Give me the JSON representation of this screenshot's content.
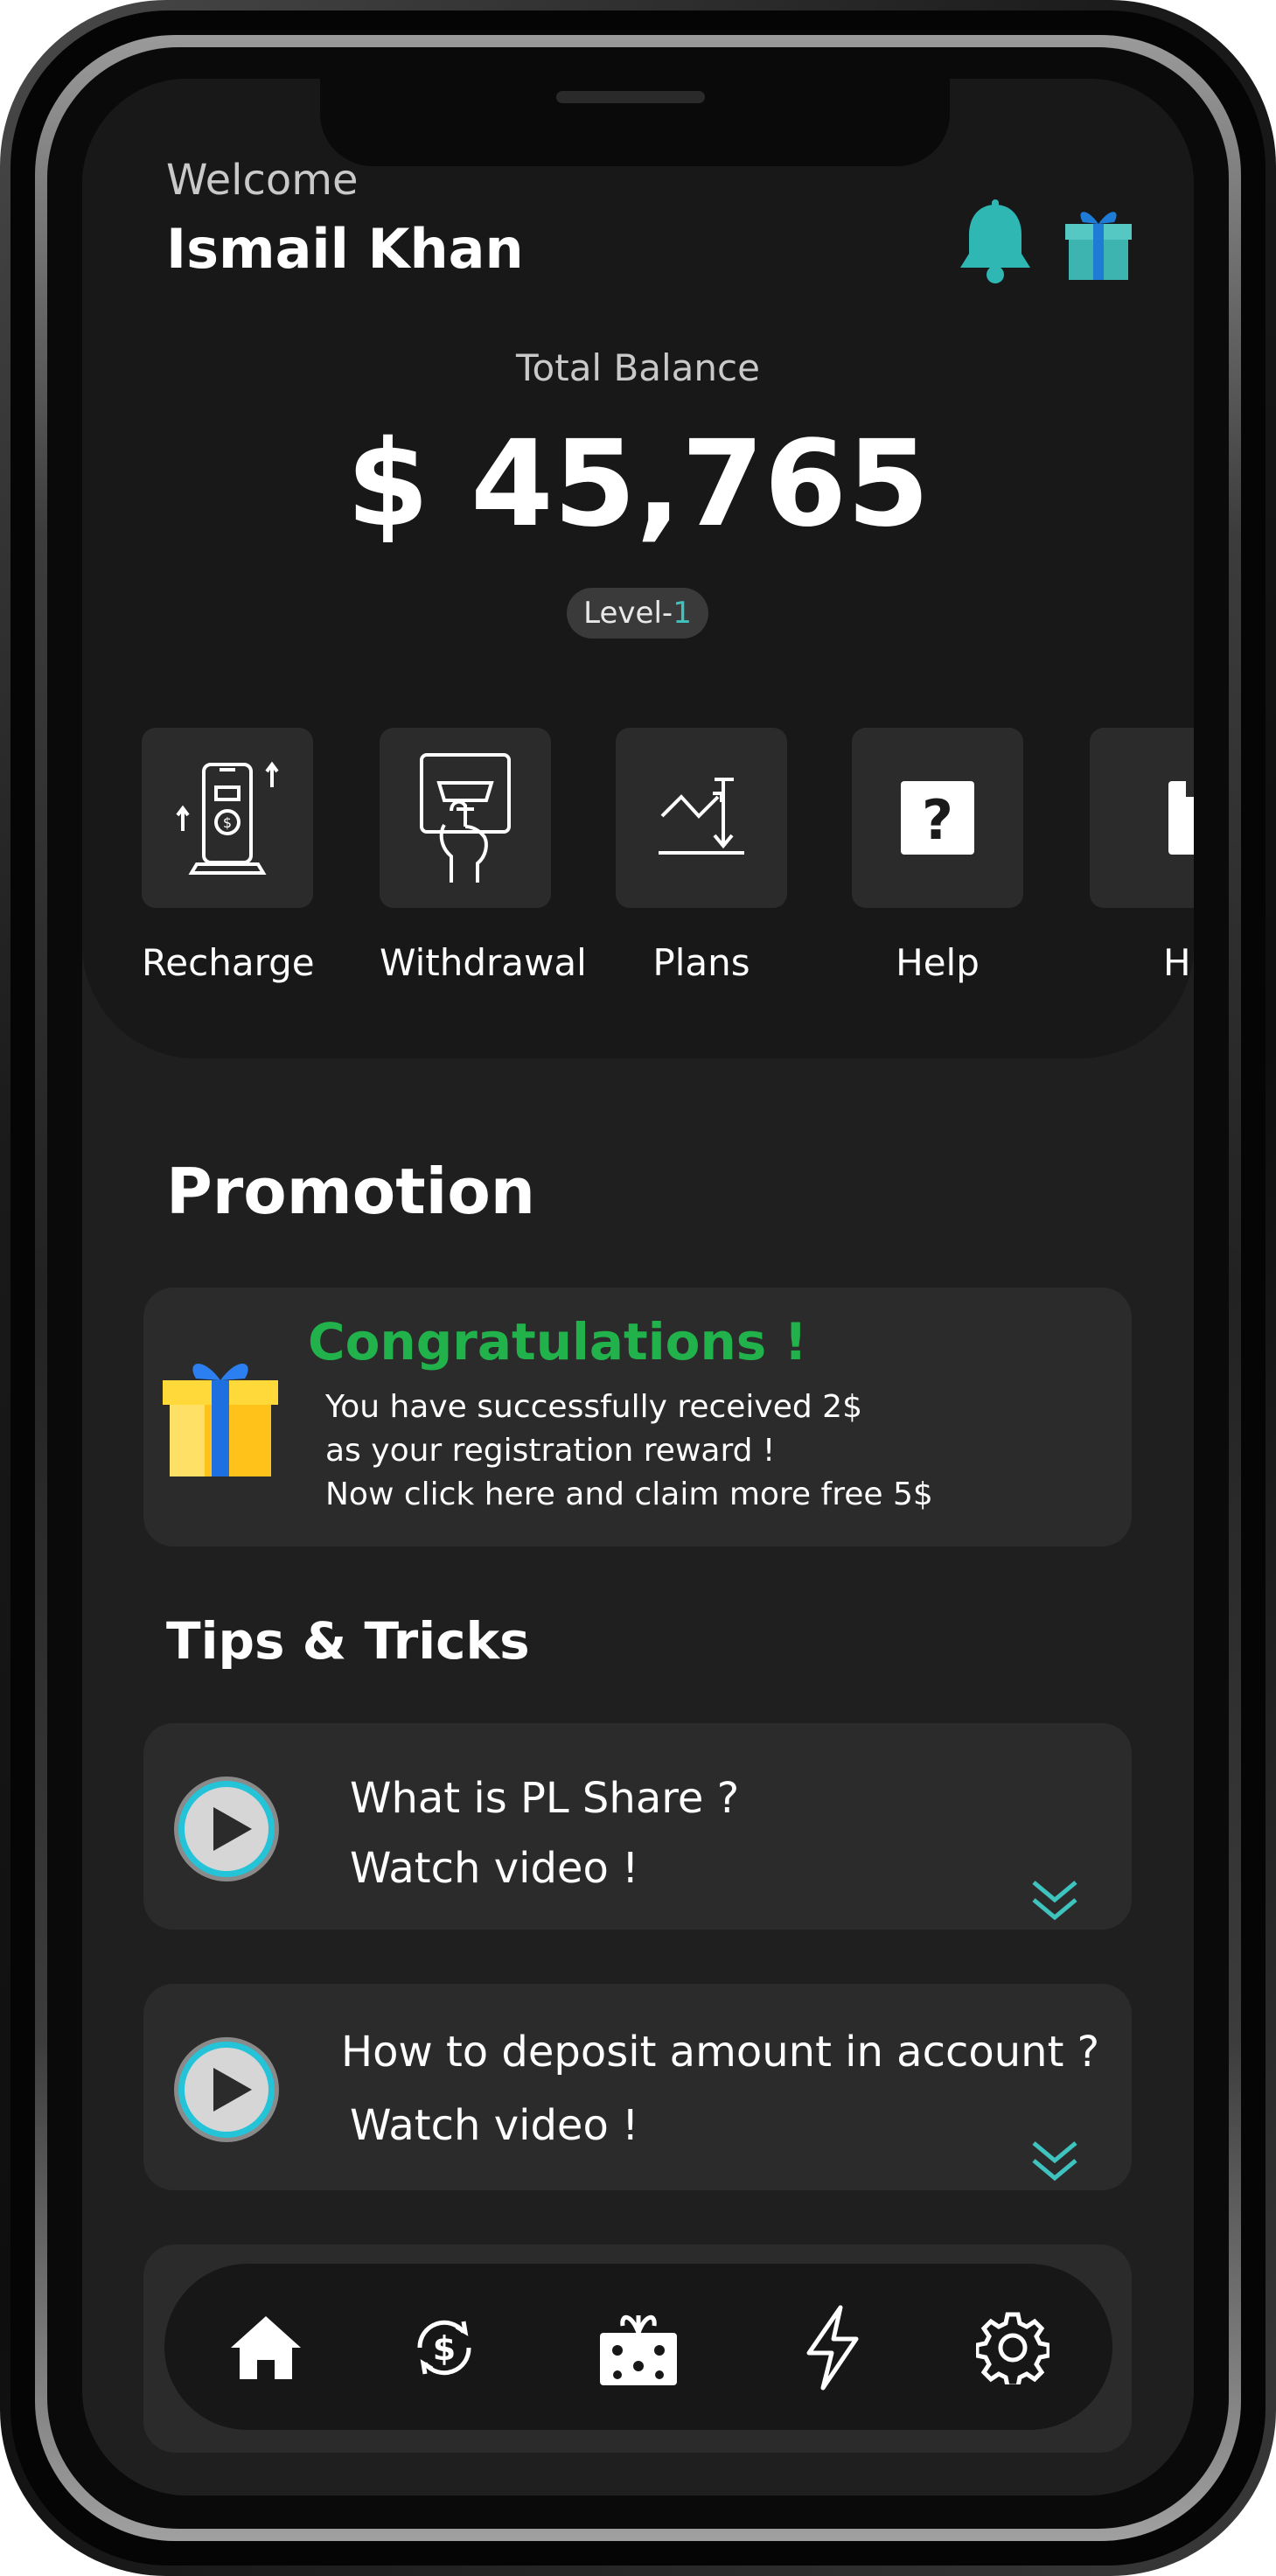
{
  "header": {
    "welcome": "Welcome",
    "user_name": "Ismail Khan",
    "notification_icon": "bell-icon",
    "gift_icon": "gift-icon"
  },
  "balance": {
    "label": "Total Balance",
    "value": "$ 45,765",
    "level_prefix": "Level-",
    "level_number": "1"
  },
  "actions": [
    {
      "label": "Recharge",
      "icon": "phone-recharge-icon"
    },
    {
      "label": "Withdrawal",
      "icon": "atm-withdrawal-icon"
    },
    {
      "label": "Plans",
      "icon": "plans-chart-icon"
    },
    {
      "label": "Help",
      "icon": "help-question-icon"
    },
    {
      "label": "H",
      "icon": "partial-icon"
    }
  ],
  "promotion": {
    "section_title": "Promotion",
    "heading": "Congratulations !",
    "line1": "You have successfully received 2$",
    "line2": "as your registration reward !",
    "line3": "Now click here and claim more free 5$"
  },
  "tips": {
    "section_title": "Tips & Tricks",
    "items": [
      {
        "title": "What is PL Share ?",
        "cta": "Watch video !"
      },
      {
        "title": "How to deposit amount in account ?",
        "cta": "Watch video !"
      }
    ]
  },
  "bottom_nav": [
    {
      "icon": "home-icon",
      "label": "Home"
    },
    {
      "icon": "currency-exchange-icon",
      "label": "Exchange"
    },
    {
      "icon": "gift-box-icon",
      "label": "Rewards"
    },
    {
      "icon": "lightning-icon",
      "label": "Power"
    },
    {
      "icon": "settings-icon",
      "label": "Settings"
    }
  ],
  "colors": {
    "accent_teal": "#3fc3bf",
    "success_green": "#22b24b",
    "background": "#1f1f1f",
    "card": "#2b2b2b"
  }
}
